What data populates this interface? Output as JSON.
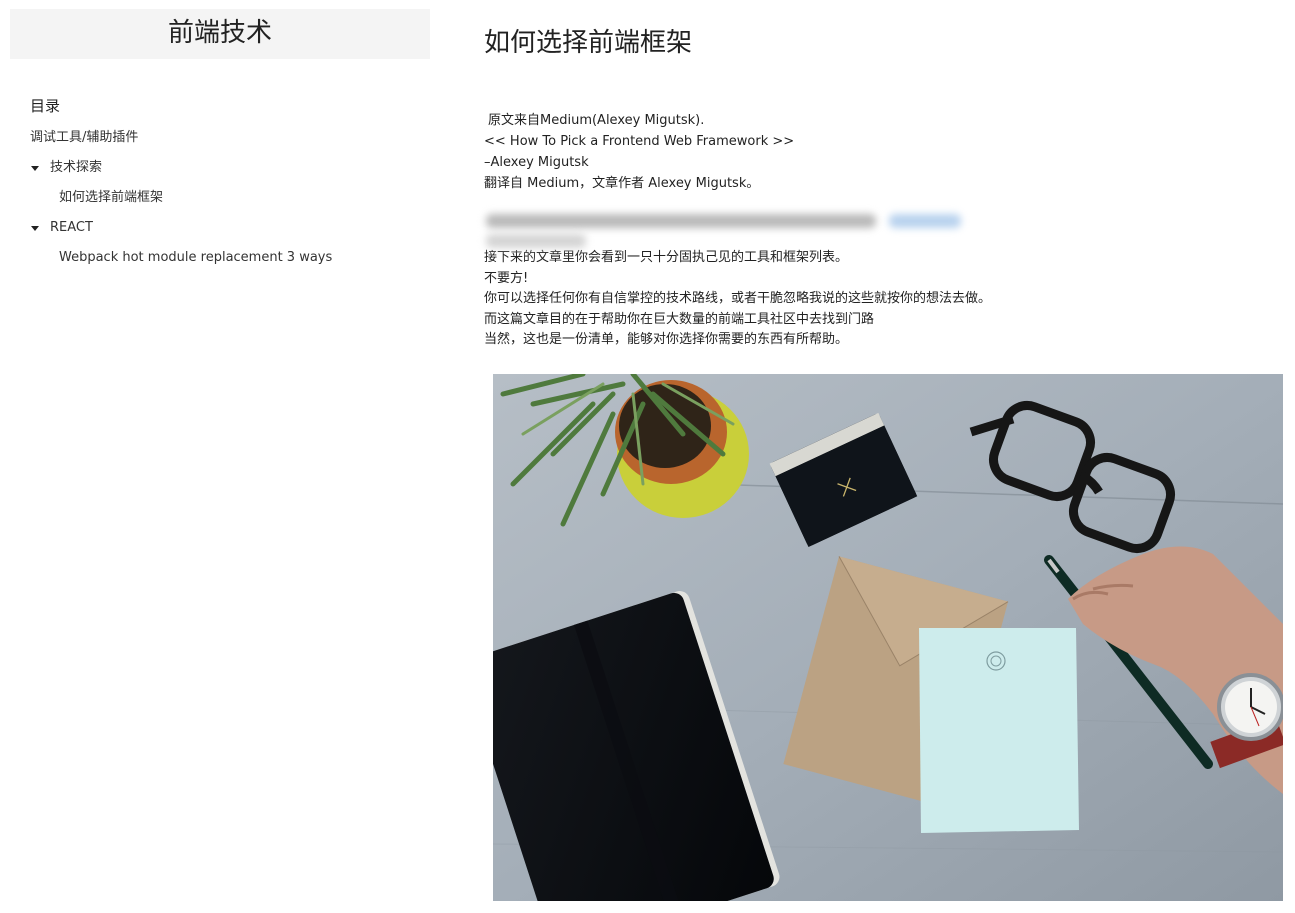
{
  "sidebar": {
    "site_title": "前端技术",
    "toc_heading": "目录",
    "items": [
      {
        "label": "调试工具/辅助插件"
      },
      {
        "label": "技术探索",
        "children": [
          {
            "label": "如何选择前端框架"
          }
        ]
      },
      {
        "label": "REACT",
        "children": [
          {
            "label": "Webpack hot module replacement 3 ways"
          }
        ]
      }
    ]
  },
  "article": {
    "title": "如何选择前端框架",
    "intro": {
      "line1": "原文来自Medium(Alexey Migutsk).",
      "line2": "<< How To Pick a Frontend Web Framework >>",
      "line3": "–Alexey Migutsk",
      "line4": "翻译自 Medium，文章作者 Alexey Migutsk。"
    },
    "paragraphs": [
      "接下来的文章里你会看到一只十分固执己见的工具和框架列表。",
      "不要方!",
      "你可以选择任何你有自信掌控的技术路线，或者干脆忽略我说的这些就按你的想法去做。",
      "而这篇文章目的在于帮助你在巨大数量的前端工具社区中去找到门路",
      "当然，这也是一份清单，能够对你选择你需要的东西有所帮助。"
    ]
  },
  "colors": {
    "title_bg": "#f4f4f4",
    "text": "#222222",
    "desk": "#a3adb6"
  }
}
